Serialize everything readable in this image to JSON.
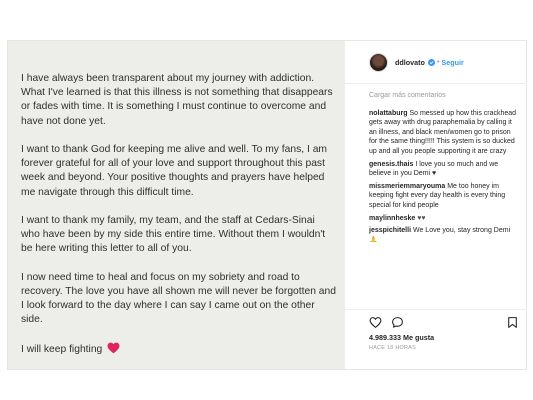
{
  "post": {
    "letter": {
      "paragraphs": [
        "I have always been transparent about my journey with addiction. What I've learned is that this illness is not something that disappears or fades with time.  It is something I must continue to overcome and have not done yet.",
        "I want to thank God for keeping me alive and well. To my fans, I am forever grateful for all of your love and support throughout this past week and beyond. Your positive thoughts and prayers have helped me navigate through this difficult time.",
        "I want to thank my family, my team, and the staff at Cedars-Sinai who have been by my side this entire time. Without them I wouldn't be here writing this letter to all of you.",
        "I now need time to heal and focus on my sobriety and road to recovery. The love you have all shown me will never be forgotten and I look forward to the day where I can say I came out on the other side."
      ],
      "closing": "I will keep fighting"
    },
    "header": {
      "username": "ddlovato",
      "separator": "•",
      "follow_label": "Seguir"
    },
    "load_more": "Cargar más comentarios",
    "comments": [
      {
        "user": "nolattaburg",
        "text": "So messed up how this crackhead gets away with drug paraphemalia by calling it an illness, and black men/women go to prison for the same thing!!!!! This system is so ducked up and all you people supporting it are crazy"
      },
      {
        "user": "genesis.thais",
        "text": "I love you so much and we believe in you Demi ♥"
      },
      {
        "user": "missmeriemmaryouma",
        "text": "Me too honey im keeping fight every day health is every thing special for kind people"
      },
      {
        "user": "maylinnheske",
        "text": "♥♥"
      },
      {
        "user": "jesspichitelli",
        "text": "We Love you, stay strong Demi 🙏"
      }
    ],
    "likes": "4.989.333 Me gusta",
    "timestamp": "HACE 18 HORAS"
  },
  "icons": {
    "verified": "verified-badge-icon",
    "like": "heart-outline-icon",
    "comment": "comment-bubble-icon",
    "save": "bookmark-icon",
    "closing_emoji": "red-heart-icon"
  },
  "colors": {
    "link": "#3897f0",
    "letter_bg": "#ededea",
    "heart": "#e0245e"
  }
}
